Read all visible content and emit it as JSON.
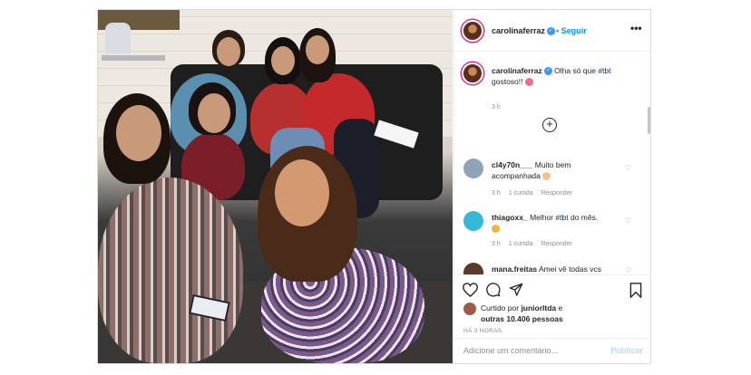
{
  "post": {
    "username": "carolinaferraz",
    "follow_label": "Seguir",
    "more_label": "•••",
    "caption_user": "carolinaferraz",
    "caption_text": "Olha só que ",
    "caption_tag": "#tbt",
    "caption_text2": " gostoso!!",
    "caption_time": "3 h",
    "load_more": "+",
    "comments": [
      {
        "user": "cl4y70n___",
        "text": "Muito bem acompanhada",
        "time": "3 h",
        "likes": "1 curtida",
        "reply": "Responder",
        "avatar_color": "#8fa3b7"
      },
      {
        "user": "thiagoxx_",
        "text_pre": "Melhor ",
        "tag": "#tbt",
        "text_post": " do mês.",
        "time": "3 h",
        "likes": "1 curtida",
        "reply": "Responder",
        "avatar_color": "#36b9d6"
      },
      {
        "user": "mana.freitas",
        "text": "Amei vê todas vcs",
        "avatar_color": "#5a3a2a"
      }
    ],
    "liked_prefix": "Curtido por",
    "liked_user": "juniorltda",
    "liked_mid": " e",
    "liked_others": "outras 10.406 pessoas",
    "post_time": "HÁ 3 HORAS",
    "add_comment_placeholder": "Adicione um comentário...",
    "publish_label": "Publicar"
  },
  "icons": {
    "heart": "heart-icon",
    "comment": "comment-icon",
    "share": "share-icon",
    "save": "bookmark-icon"
  },
  "colors": {
    "link_blue": "#0095f6",
    "verified_blue": "#3897f0",
    "muted": "#8e8e8e",
    "publish_disabled": "#b2dffc"
  }
}
